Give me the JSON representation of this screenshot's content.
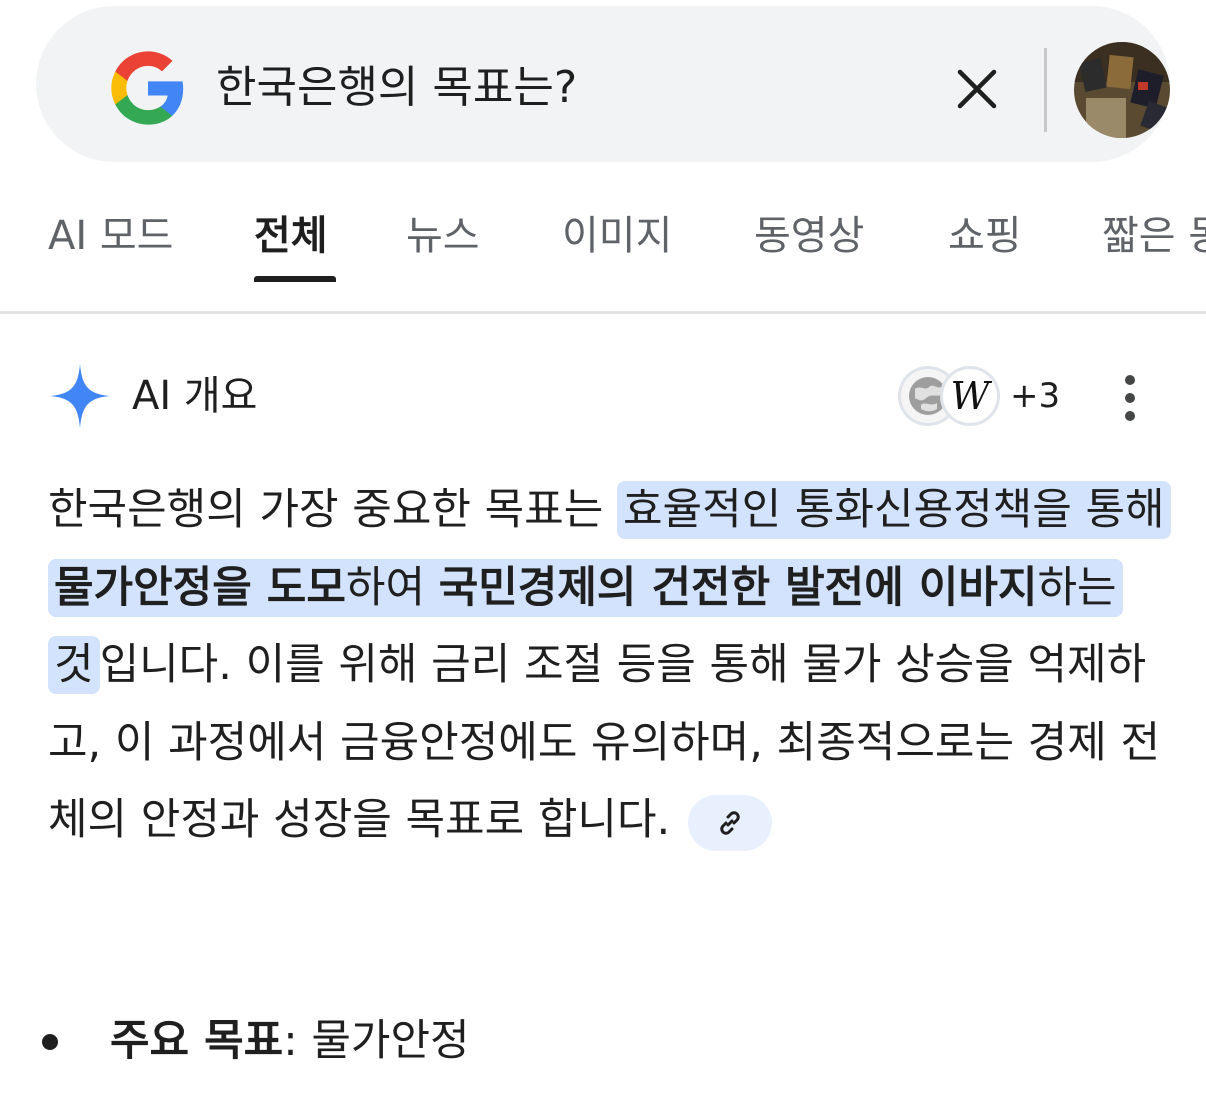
{
  "search": {
    "query": "한국은행의 목표는?",
    "logo_icon": "google-g-icon",
    "clear_icon": "close-icon",
    "avatar_icon": "profile-avatar"
  },
  "tabs": [
    {
      "label": "AI 모드"
    },
    {
      "label": "전체"
    },
    {
      "label": "뉴스"
    },
    {
      "label": "이미지"
    },
    {
      "label": "동영상"
    },
    {
      "label": "쇼핑"
    },
    {
      "label": "짧은 동"
    }
  ],
  "active_tab": "전체",
  "ai_overview": {
    "title": "AI 개요",
    "sources_more": "+3",
    "text": {
      "p1": "한국은행의 가장 중요한 목표는 ",
      "h1": "효율적인 통화신용정책을 통해 ",
      "h1b": "물가안정을 도모",
      "h2": "하여 ",
      "h2b": "국민경제의 건전한 발전에 이바지",
      "h3": "하는 것",
      "p2": "입니다. 이를 위해 금리 조절 등을 통해 물가 상승을 억제하고, 이 과정에서 금융안정에도 유의하며, 최종적으로는 경제 전체의 안정과 성장을 목표로 합니다."
    },
    "bullet": {
      "label": "주요 목표",
      "sep": ": ",
      "value": "물가안정"
    }
  },
  "colors": {
    "highlight": "#d3e3fd",
    "text": "#1f1f1f",
    "muted": "#5f6368",
    "sparkle": "#4285f4"
  }
}
